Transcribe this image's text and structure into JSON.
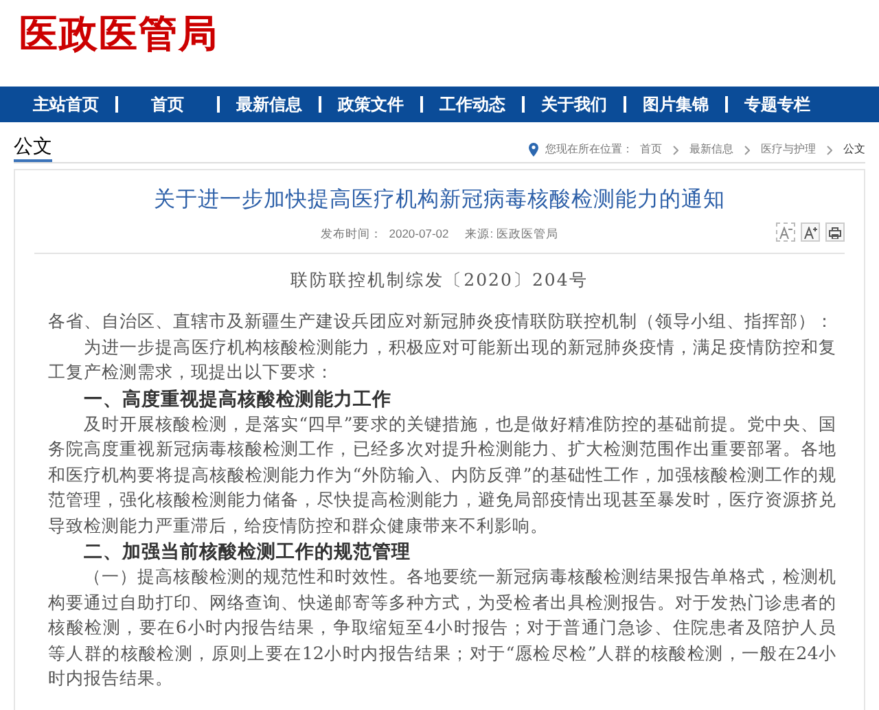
{
  "site_title": "医政医管局",
  "nav": [
    {
      "label": "主站首页"
    },
    {
      "label": "首页"
    },
    {
      "label": "最新信息"
    },
    {
      "label": "政策文件"
    },
    {
      "label": "工作动态"
    },
    {
      "label": "关于我们"
    },
    {
      "label": "图片集锦"
    },
    {
      "label": "专题专栏"
    }
  ],
  "section_title": "公文",
  "breadcrumb": {
    "prefix": "您现在所在位置：",
    "items": [
      "首页",
      "最新信息",
      "医疗与护理",
      "公文"
    ]
  },
  "article": {
    "title": "关于进一步加快提高医疗机构新冠病毒核酸检测能力的通知",
    "published_label": "发布时间：",
    "published": "2020-07-02",
    "source": "来源: 医政医管局",
    "doc_number": "联防联控机制综发〔2020〕204号",
    "paragraphs": [
      {
        "kind": "address",
        "text": "各省、自治区、直辖市及新疆生产建设兵团应对新冠肺炎疫情联防联控机制（领导小组、指挥部）："
      },
      {
        "kind": "body",
        "text": "为进一步提高医疗机构核酸检测能力，积极应对可能新出现的新冠肺炎疫情，满足疫情防控和复工复产检测需求，现提出以下要求："
      },
      {
        "kind": "heading",
        "text": "一、高度重视提高核酸检测能力工作"
      },
      {
        "kind": "body",
        "text": "及时开展核酸检测，是落实“四早”要求的关键措施，也是做好精准防控的基础前提。党中央、国务院高度重视新冠病毒核酸检测工作，已经多次对提升检测能力、扩大检测范围作出重要部署。各地和医疗机构要将提高核酸检测能力作为“外防输入、内防反弹”的基础性工作，加强核酸检测工作的规范管理，强化核酸检测能力储备，尽快提高检测能力，避免局部疫情出现甚至暴发时，医疗资源挤兑导致检测能力严重滞后，给疫情防控和群众健康带来不利影响。"
      },
      {
        "kind": "heading",
        "text": "二、加强当前核酸检测工作的规范管理"
      },
      {
        "kind": "body",
        "text": "（一）提高核酸检测的规范性和时效性。各地要统一新冠病毒核酸检测结果报告单格式，检测机构要通过自助打印、网络查询、快递邮寄等多种方式，为受检者出具检测报告。对于发热门诊患者的核酸检测，要在6小时内报告结果，争取缩短至4小时报告；对于普通门急诊、住院患者及陪护人员等人群的核酸检测，原则上要在12小时内报告结果；对于“愿检尽检”人群的核酸检测，一般在24小时内报告结果。"
      }
    ]
  }
}
